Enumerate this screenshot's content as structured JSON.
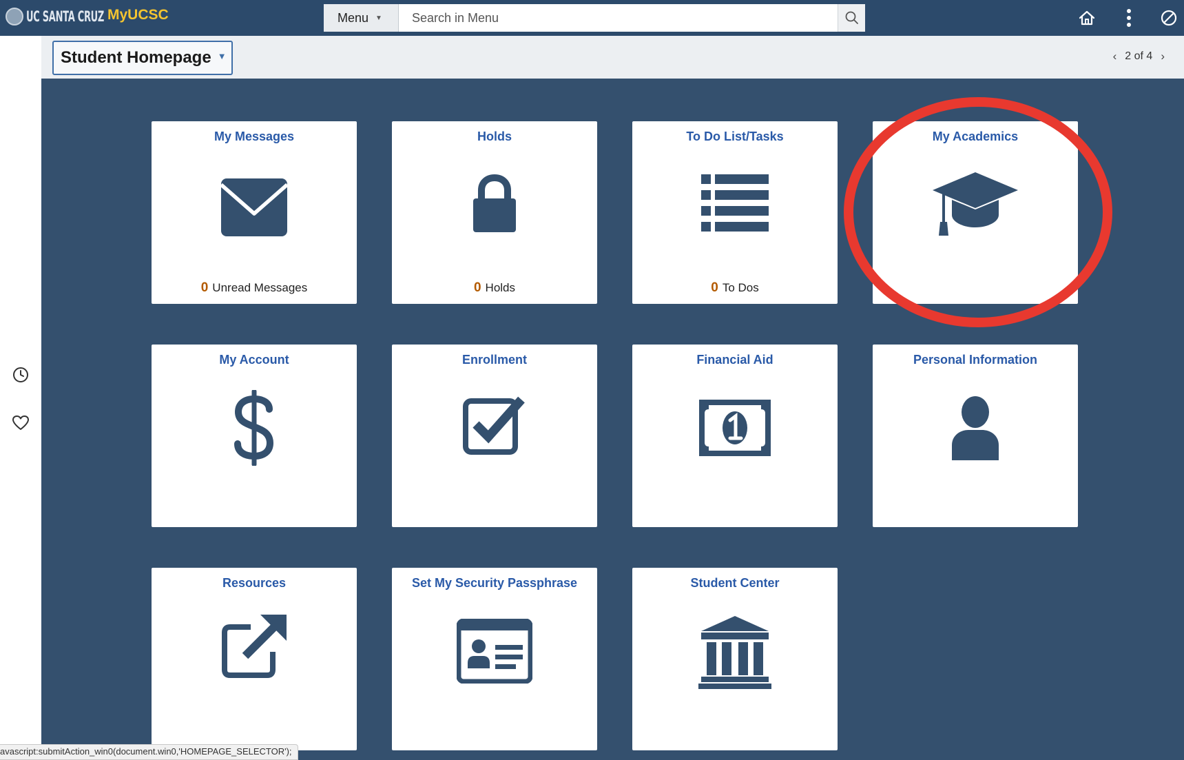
{
  "topbar": {
    "brand_seal_text": "UC SANTA CRUZ",
    "brand_app": "MyUCSC",
    "menu_label": "Menu",
    "search_placeholder": "Search in Menu",
    "icons": [
      "search-icon",
      "home-icon",
      "kebab-menu-icon",
      "no-entry-icon"
    ]
  },
  "subheader": {
    "homepage_selector": "Student Homepage",
    "pager": "2 of 4"
  },
  "siderail": {
    "icons": [
      "recent-history-icon",
      "favorites-heart-icon"
    ]
  },
  "tiles": [
    {
      "title": "My Messages",
      "icon": "envelope-icon",
      "count": "0",
      "count_label": "Unread Messages"
    },
    {
      "title": "Holds",
      "icon": "padlock-icon",
      "count": "0",
      "count_label": "Holds"
    },
    {
      "title": "To Do List/Tasks",
      "icon": "list-icon",
      "count": "0",
      "count_label": "To Dos"
    },
    {
      "title": "My Academics",
      "icon": "graduation-cap-icon"
    },
    {
      "title": "My Account",
      "icon": "dollar-sign-icon"
    },
    {
      "title": "Enrollment",
      "icon": "checkbox-checked-icon"
    },
    {
      "title": "Financial Aid",
      "icon": "dollar-bill-icon"
    },
    {
      "title": "Personal Information",
      "icon": "person-icon"
    },
    {
      "title": "Resources",
      "icon": "external-link-icon"
    },
    {
      "title": "Set My Security Passphrase",
      "icon": "id-card-icon"
    },
    {
      "title": "Student Center",
      "icon": "institution-building-icon"
    }
  ],
  "annotation": {
    "highlighted_tile": "My Academics",
    "color": "#e8392f"
  },
  "colors": {
    "background": "#34506e",
    "topbar": "#2c4a6b",
    "brand_app": "#f4c430",
    "tile_title": "#2a5aa8",
    "icon": "#34506e",
    "count": "#b35a00"
  },
  "statusbar": "avascript:submitAction_win0(document.win0,'HOMEPAGE_SELECTOR');"
}
